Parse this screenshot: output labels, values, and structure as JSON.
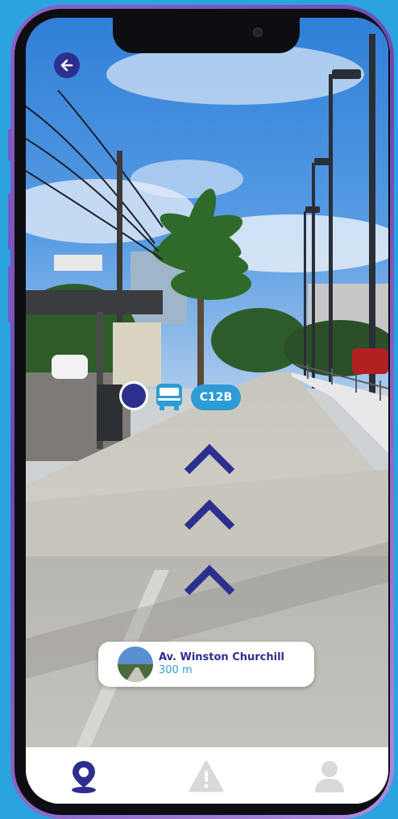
{
  "colors": {
    "primary": "#2d2f8f",
    "accent": "#2d9bd6",
    "inactive": "#d9d9d9",
    "background": "#2aa3de"
  },
  "header": {
    "back_icon": "arrow-left-icon"
  },
  "ar_overlay": {
    "position_marker_icon": "circle-marker-icon",
    "bus_icon": "bus-icon",
    "route_label": "C12B",
    "direction_icon": "chevron-up-icon",
    "direction_count": 3
  },
  "destination": {
    "name": "Av. Winston Churchill",
    "distance": "300 m",
    "thumbnail_icon": "street-photo-thumbnail"
  },
  "tabs": [
    {
      "icon": "map-pin-icon",
      "active": true
    },
    {
      "icon": "warning-icon",
      "active": false
    },
    {
      "icon": "user-icon",
      "active": false
    }
  ]
}
